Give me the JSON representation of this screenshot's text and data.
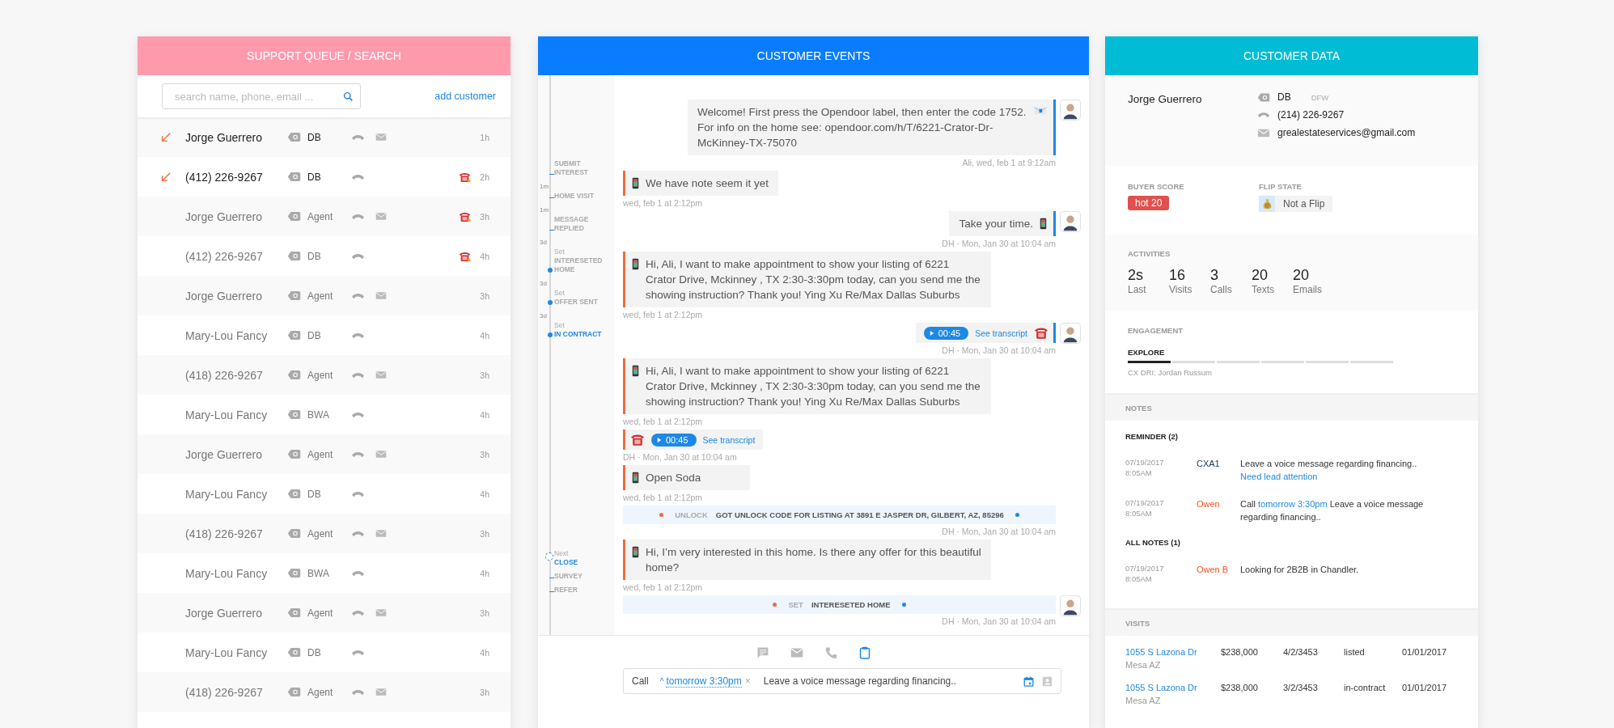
{
  "queue": {
    "title": "SUPPORT QUEUE / SEARCH",
    "search": {
      "placeholder": "search name, phone, email ..."
    },
    "add_link": "add customer",
    "rows": [
      {
        "name": "Jorge Guerrero",
        "tag": "DB",
        "time": "1h",
        "unread": true,
        "email": true,
        "urgent": false
      },
      {
        "name": "(412) 226-9267",
        "tag": "DB",
        "time": "2h",
        "unread": true,
        "email": false,
        "urgent": true
      },
      {
        "name": "Jorge Guerrero",
        "tag": "Agent",
        "time": "3h",
        "unread": false,
        "email": true,
        "urgent": true
      },
      {
        "name": "(412) 226-9267",
        "tag": "DB",
        "time": "4h",
        "unread": false,
        "email": false,
        "urgent": true
      },
      {
        "name": "Jorge Guerrero",
        "tag": "Agent",
        "time": "3h",
        "unread": false,
        "email": true,
        "urgent": false
      },
      {
        "name": "Mary-Lou Fancy",
        "tag": "DB",
        "time": "4h",
        "unread": false,
        "email": false,
        "urgent": false
      },
      {
        "name": "(418) 226-9267",
        "tag": "Agent",
        "time": "3h",
        "unread": false,
        "email": true,
        "urgent": false
      },
      {
        "name": "Mary-Lou Fancy",
        "tag": "BWA",
        "time": "4h",
        "unread": false,
        "email": false,
        "urgent": false
      },
      {
        "name": "Jorge Guerrero",
        "tag": "Agent",
        "time": "3h",
        "unread": false,
        "email": true,
        "urgent": false
      },
      {
        "name": "Mary-Lou Fancy",
        "tag": "DB",
        "time": "4h",
        "unread": false,
        "email": false,
        "urgent": false
      },
      {
        "name": "(418) 226-9267",
        "tag": "Agent",
        "time": "3h",
        "unread": false,
        "email": true,
        "urgent": false
      },
      {
        "name": "Mary-Lou Fancy",
        "tag": "BWA",
        "time": "4h",
        "unread": false,
        "email": false,
        "urgent": false
      },
      {
        "name": "Jorge Guerrero",
        "tag": "Agent",
        "time": "3h",
        "unread": false,
        "email": true,
        "urgent": false
      },
      {
        "name": "Mary-Lou Fancy",
        "tag": "DB",
        "time": "4h",
        "unread": false,
        "email": false,
        "urgent": false
      },
      {
        "name": "(418) 226-9267",
        "tag": "Agent",
        "time": "3h",
        "unread": false,
        "email": true,
        "urgent": false
      }
    ]
  },
  "events": {
    "title": "CUSTOMER EVENTS",
    "timeline": {
      "past": [
        {
          "kind": "tick",
          "label": "SUBMIT INTEREST",
          "current": false
        },
        {
          "kind": "gap",
          "text": "1m"
        },
        {
          "kind": "tick",
          "label": "HOME VISIT",
          "current": false
        },
        {
          "kind": "gap",
          "text": "1m"
        },
        {
          "kind": "tick",
          "label": "MESSAGE REPLIED",
          "current": false
        },
        {
          "kind": "gap",
          "text": "3d"
        },
        {
          "kind": "dot",
          "prefix": "Set",
          "label": "INTERESETED HOME",
          "current": false
        },
        {
          "kind": "gap",
          "text": "3d"
        },
        {
          "kind": "dot",
          "prefix": "Set",
          "label": "OFFER SENT",
          "current": false
        },
        {
          "kind": "gap",
          "text": "3d"
        },
        {
          "kind": "dot",
          "prefix": "Set",
          "label": "IN CONTRACT",
          "current": true
        }
      ],
      "upcoming": [
        {
          "kind": "ring",
          "prefix": "Next",
          "label": "CLOSE",
          "current": true
        },
        {
          "kind": "tick",
          "label": "SURVEY",
          "current": false
        },
        {
          "kind": "tick",
          "label": "REFER",
          "current": false
        }
      ]
    },
    "messages": [
      {
        "kind": "email",
        "outgoing": true,
        "avatar": true,
        "text": "Welcome! First press the Opendoor label, then enter the code 1752. For info on the home see: opendoor.com/h/T/6221-Crator-Dr-McKinney-TX-75070",
        "meta": "Ali, wed, feb 1 at 9:12am"
      },
      {
        "kind": "sms",
        "outgoing": false,
        "avatar": false,
        "text": "We have note seem it yet",
        "meta": "wed, feb 1 at 2:12pm"
      },
      {
        "kind": "sms",
        "outgoing": true,
        "avatar": true,
        "text": "Take your time.",
        "meta": "DH · Mon, Jan 30 at 10:04 am"
      },
      {
        "kind": "sms",
        "outgoing": false,
        "avatar": false,
        "text": "Hi, Ali, I want to make appointment to show your listing of 6221 Crator Drive, Mckinney , TX 2:30-3:30pm today, can you send me the showing instruction? Thank you! Ying Xu Re/Max Dallas Suburbs",
        "meta": "wed, feb 1 at 2:12pm"
      },
      {
        "kind": "call",
        "outgoing": true,
        "avatar": true,
        "duration": "00:45",
        "link": "See transcript",
        "meta": "DH · Mon, Jan 30 at 10:04 am"
      },
      {
        "kind": "sms",
        "outgoing": false,
        "avatar": false,
        "text": "Hi, Ali, I want to make appointment to show your listing of 6221 Crator Drive, Mckinney , TX 2:30-3:30pm today, can you send me the showing instruction? Thank you! Ying Xu Re/Max Dallas Suburbs",
        "meta": "wed, feb 1 at 2:12pm"
      },
      {
        "kind": "call",
        "outgoing": false,
        "avatar": false,
        "duration": "00:45",
        "link": "See transcript",
        "meta": "DH · Mon, Jan 30 at 10:04 am"
      },
      {
        "kind": "sms",
        "outgoing": false,
        "avatar": false,
        "text": "Open Soda",
        "meta": "wed, feb 1 at 2:12pm"
      },
      {
        "kind": "event",
        "avatar": false,
        "tag": "UNLOCK",
        "text": "GOT UNLOCK CODE FOR LISTING AT 3891 E JASPER DR, GILBERT, AZ, 85296",
        "meta": "DH · Mon, Jan 30 at 10:04 am"
      },
      {
        "kind": "sms",
        "outgoing": false,
        "avatar": false,
        "text": "Hi, I’m very interested in this home. Is there any offer for this beautiful home?",
        "meta": "wed, feb 1 at 2:12pm"
      },
      {
        "kind": "event",
        "avatar": true,
        "tag": "SET",
        "text": "INTERESETED HOME",
        "meta": "DH · Mon, Jan 30 at 10:04 am"
      }
    ],
    "composer": {
      "tabs": [
        {
          "kind": "chat",
          "selected": false
        },
        {
          "kind": "email",
          "selected": false
        },
        {
          "kind": "phone",
          "selected": false
        },
        {
          "kind": "task",
          "selected": true
        }
      ],
      "action": "Call",
      "caret": "^",
      "due": "tomorrow 3:30pm",
      "clear": "×",
      "value": "Leave a voice message regarding financing.."
    }
  },
  "customer": {
    "title": "CUSTOMER DATA",
    "name": "Jorge Guerrero",
    "tag": "DB",
    "region": "DFW",
    "phone": "(214) 226-9267",
    "email": "grealestateservices@gmail.com",
    "buyer_score": {
      "label": "BUYER SCORE",
      "value": "hot 20"
    },
    "flip_state": {
      "label": "FLIP STATE",
      "value": "Not a Flip"
    },
    "activities": {
      "label": "ACTIVITIES",
      "stats": [
        {
          "value": "2s",
          "label": "Last"
        },
        {
          "value": "16",
          "label": "Visits"
        },
        {
          "value": "3",
          "label": "Calls"
        },
        {
          "value": "20",
          "label": "Texts"
        },
        {
          "value": "20",
          "label": "Emails"
        }
      ]
    },
    "engagement": {
      "label": "ENGAGEMENT",
      "stage": "EXPLORE",
      "steps": [
        {
          "done": true
        },
        {
          "done": false
        },
        {
          "done": false
        },
        {
          "done": false
        },
        {
          "done": false
        },
        {
          "done": false
        }
      ],
      "owner": "CX DRI: Jordan Russum"
    },
    "notes": {
      "label": "NOTES",
      "groups": [
        {
          "title": "REMINDER (2)",
          "items": [
            {
              "date": "07/19/2017",
              "time": "8:05AM",
              "author": "CXA1",
              "color": "#1b3a66",
              "parts": [
                {
                  "kind": "text",
                  "text": "Leave a voice message regarding financing.."
                },
                {
                  "kind": "link",
                  "text": "Need lead attention"
                }
              ]
            },
            {
              "date": "07/19/2017",
              "time": "8:05AM",
              "author": "Owen",
              "color": "#f4511e",
              "parts": [
                {
                  "kind": "text",
                  "text": "Call"
                },
                {
                  "kind": "link",
                  "text": "tomorrow 3:30pm"
                },
                {
                  "kind": "text",
                  "text": "Leave a voice message regarding financing.."
                }
              ]
            }
          ]
        },
        {
          "title": "ALL NOTES (1)",
          "items": [
            {
              "date": "07/19/2017",
              "time": "8:05AM",
              "author": "Owen B",
              "color": "#f4511e",
              "parts": [
                {
                  "kind": "text",
                  "text": "Looking for 2B2B in Chandler."
                }
              ]
            }
          ]
        }
      ]
    },
    "visits": {
      "label": "VISITS",
      "rows": [
        {
          "address": "1055 S Lazona Dr",
          "city": "Mesa AZ",
          "price": "$238,000",
          "rooms": "4/2/3453",
          "status": "listed",
          "date": "01/01/2017"
        },
        {
          "address": "1055 S Lazona Dr",
          "city": "Mesa AZ",
          "price": "$238,000",
          "rooms": "3/2/3453",
          "status": "in-contract",
          "date": "01/01/2017"
        }
      ]
    }
  }
}
